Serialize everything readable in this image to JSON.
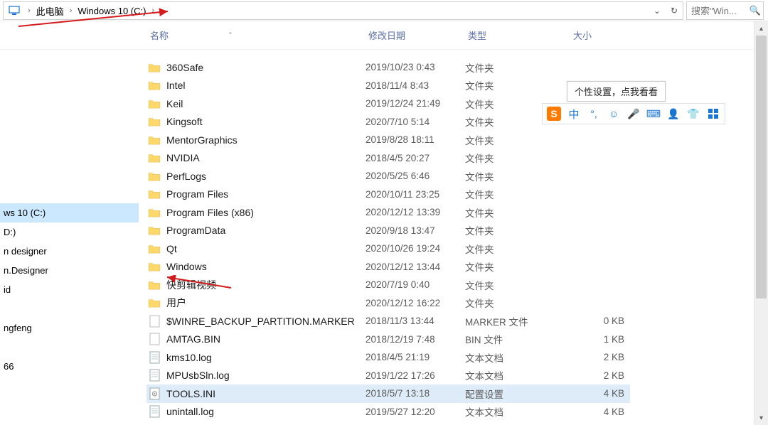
{
  "breadcrumb": {
    "parts": [
      "此电脑",
      "Windows 10 (C:)"
    ]
  },
  "search": {
    "placeholder": "搜索\"Win..."
  },
  "columns": {
    "name": "名称",
    "date": "修改日期",
    "type": "类型",
    "size": "大小"
  },
  "sidebar": {
    "items": [
      {
        "label": "",
        "selected": false,
        "gap": true
      },
      {
        "label": "",
        "selected": false,
        "gap": true
      },
      {
        "label": "",
        "selected": false,
        "gap": true
      },
      {
        "label": "",
        "selected": false,
        "gap": true
      },
      {
        "label": "",
        "selected": false,
        "gap": true
      },
      {
        "label": "",
        "selected": false,
        "gap": true
      },
      {
        "label": "",
        "selected": false,
        "gap": true
      },
      {
        "label": "",
        "selected": false,
        "gap": true
      },
      {
        "label": "ws 10 (C:)",
        "selected": true
      },
      {
        "label": "D:)",
        "selected": false
      },
      {
        "label": "n designer",
        "selected": false
      },
      {
        "label": "n.Designer",
        "selected": false
      },
      {
        "label": "id",
        "selected": false
      },
      {
        "label": "",
        "selected": false,
        "gap": true
      },
      {
        "label": "ngfeng",
        "selected": false
      },
      {
        "label": "",
        "selected": false,
        "gap": true
      },
      {
        "label": "66",
        "selected": false
      }
    ]
  },
  "files": [
    {
      "icon": "folder",
      "name": "360Safe",
      "date": "2019/10/23 0:43",
      "type": "文件夹",
      "size": ""
    },
    {
      "icon": "folder",
      "name": "Intel",
      "date": "2018/11/4 8:43",
      "type": "文件夹",
      "size": ""
    },
    {
      "icon": "folder",
      "name": "Keil",
      "date": "2019/12/24 21:49",
      "type": "文件夹",
      "size": ""
    },
    {
      "icon": "folder",
      "name": "Kingsoft",
      "date": "2020/7/10 5:14",
      "type": "文件夹",
      "size": ""
    },
    {
      "icon": "folder",
      "name": "MentorGraphics",
      "date": "2019/8/28 18:11",
      "type": "文件夹",
      "size": ""
    },
    {
      "icon": "folder",
      "name": "NVIDIA",
      "date": "2018/4/5 20:27",
      "type": "文件夹",
      "size": ""
    },
    {
      "icon": "folder",
      "name": "PerfLogs",
      "date": "2020/5/25 6:46",
      "type": "文件夹",
      "size": ""
    },
    {
      "icon": "folder",
      "name": "Program Files",
      "date": "2020/10/11 23:25",
      "type": "文件夹",
      "size": ""
    },
    {
      "icon": "folder",
      "name": "Program Files (x86)",
      "date": "2020/12/12 13:39",
      "type": "文件夹",
      "size": ""
    },
    {
      "icon": "folder",
      "name": "ProgramData",
      "date": "2020/9/18 13:47",
      "type": "文件夹",
      "size": ""
    },
    {
      "icon": "folder",
      "name": "Qt",
      "date": "2020/10/26 19:24",
      "type": "文件夹",
      "size": ""
    },
    {
      "icon": "folder",
      "name": "Windows",
      "date": "2020/12/12 13:44",
      "type": "文件夹",
      "size": ""
    },
    {
      "icon": "folder",
      "name": "快剪辑视频",
      "date": "2020/7/19 0:40",
      "type": "文件夹",
      "size": ""
    },
    {
      "icon": "folder",
      "name": "用户",
      "date": "2020/12/12 16:22",
      "type": "文件夹",
      "size": ""
    },
    {
      "icon": "file",
      "name": "$WINRE_BACKUP_PARTITION.MARKER",
      "date": "2018/11/3 13:44",
      "type": "MARKER 文件",
      "size": "0 KB"
    },
    {
      "icon": "file",
      "name": "AMTAG.BIN",
      "date": "2018/12/19 7:48",
      "type": "BIN 文件",
      "size": "1 KB"
    },
    {
      "icon": "doc",
      "name": "kms10.log",
      "date": "2018/4/5 21:19",
      "type": "文本文档",
      "size": "2 KB"
    },
    {
      "icon": "doc",
      "name": "MPUsbSln.log",
      "date": "2019/1/22 17:26",
      "type": "文本文档",
      "size": "2 KB"
    },
    {
      "icon": "ini",
      "name": "TOOLS.INI",
      "date": "2018/5/7 13:18",
      "type": "配置设置",
      "size": "4 KB",
      "selected": true
    },
    {
      "icon": "doc",
      "name": "unintall.log",
      "date": "2019/5/27 12:20",
      "type": "文本文档",
      "size": "4 KB"
    }
  ],
  "ime": {
    "tip": "个性设置，点我看看",
    "icons": {
      "sogou": "S",
      "lang": "中"
    }
  }
}
